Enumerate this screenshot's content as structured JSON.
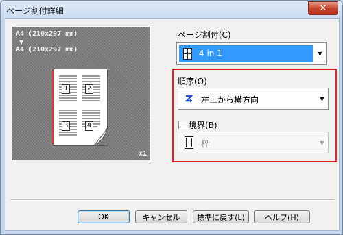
{
  "window": {
    "title": "ページ割付詳細",
    "close_glyph": "✕"
  },
  "preview": {
    "source_size": "A4 (210x297 mm)",
    "arrow": "▼",
    "target_size": "A4 (210x297 mm)",
    "copies": "x1",
    "cells": [
      "1",
      "2",
      "3",
      "4"
    ]
  },
  "page_layout": {
    "label": "ページ割付(C)",
    "value": "4 in 1",
    "icon": "four-panel-icon"
  },
  "order": {
    "label": "順序(O)",
    "value": "左上から横方向",
    "icon": "z-order-icon"
  },
  "border": {
    "label": "境界(B)",
    "checked": false,
    "value": "枠",
    "enabled": false,
    "icon": "frame-icon"
  },
  "buttons": {
    "ok": "OK",
    "cancel": "キャンセル",
    "reset": "標準に戻す(L)",
    "help": "ヘルプ(H)"
  },
  "colors": {
    "highlight": "#e0202a",
    "selection": "#3399ff"
  }
}
